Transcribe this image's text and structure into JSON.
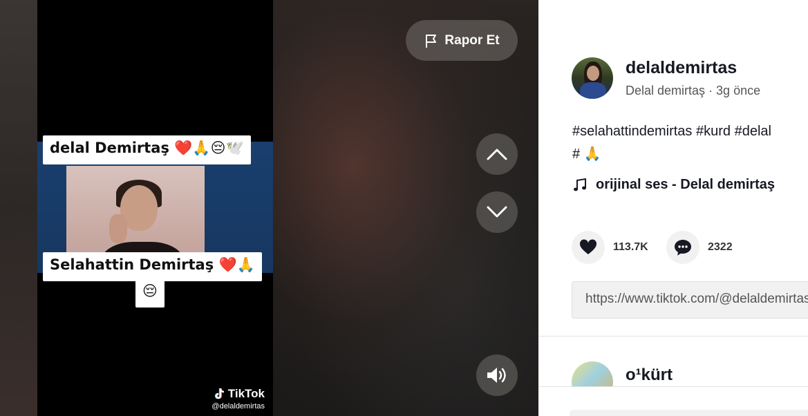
{
  "overlay": {
    "report_label": "Rapor Et"
  },
  "video": {
    "caption_top": "delal Demirtaş ❤️🙏😔🕊️",
    "caption_bottom": "Selahattin Demirtaş ❤️🙏",
    "caption_bottom_emoji": "😔",
    "watermark_brand": "TikTok",
    "watermark_handle": "@delaldemirtas"
  },
  "author": {
    "username": "delaldemirtas",
    "display_name": "Delal demirtaş",
    "separator": " · ",
    "time_ago": "3g önce"
  },
  "post": {
    "description_line1": "#selahattindemirtas #kurd #delal",
    "description_line2": "# 🙏",
    "music": "orijinal ses - Delal demirtaş",
    "likes": "113.7K",
    "comments": "2322",
    "share_link": "https://www.tiktok.com/@delaldemirtas"
  },
  "comment_preview": {
    "username": "o¹kürt"
  },
  "icons": {
    "report": "flag-icon",
    "prev": "chevron-up-icon",
    "next": "chevron-down-icon",
    "volume": "speaker-icon",
    "music": "music-note-icon",
    "like": "heart-icon",
    "comment": "comment-bubble-icon"
  }
}
